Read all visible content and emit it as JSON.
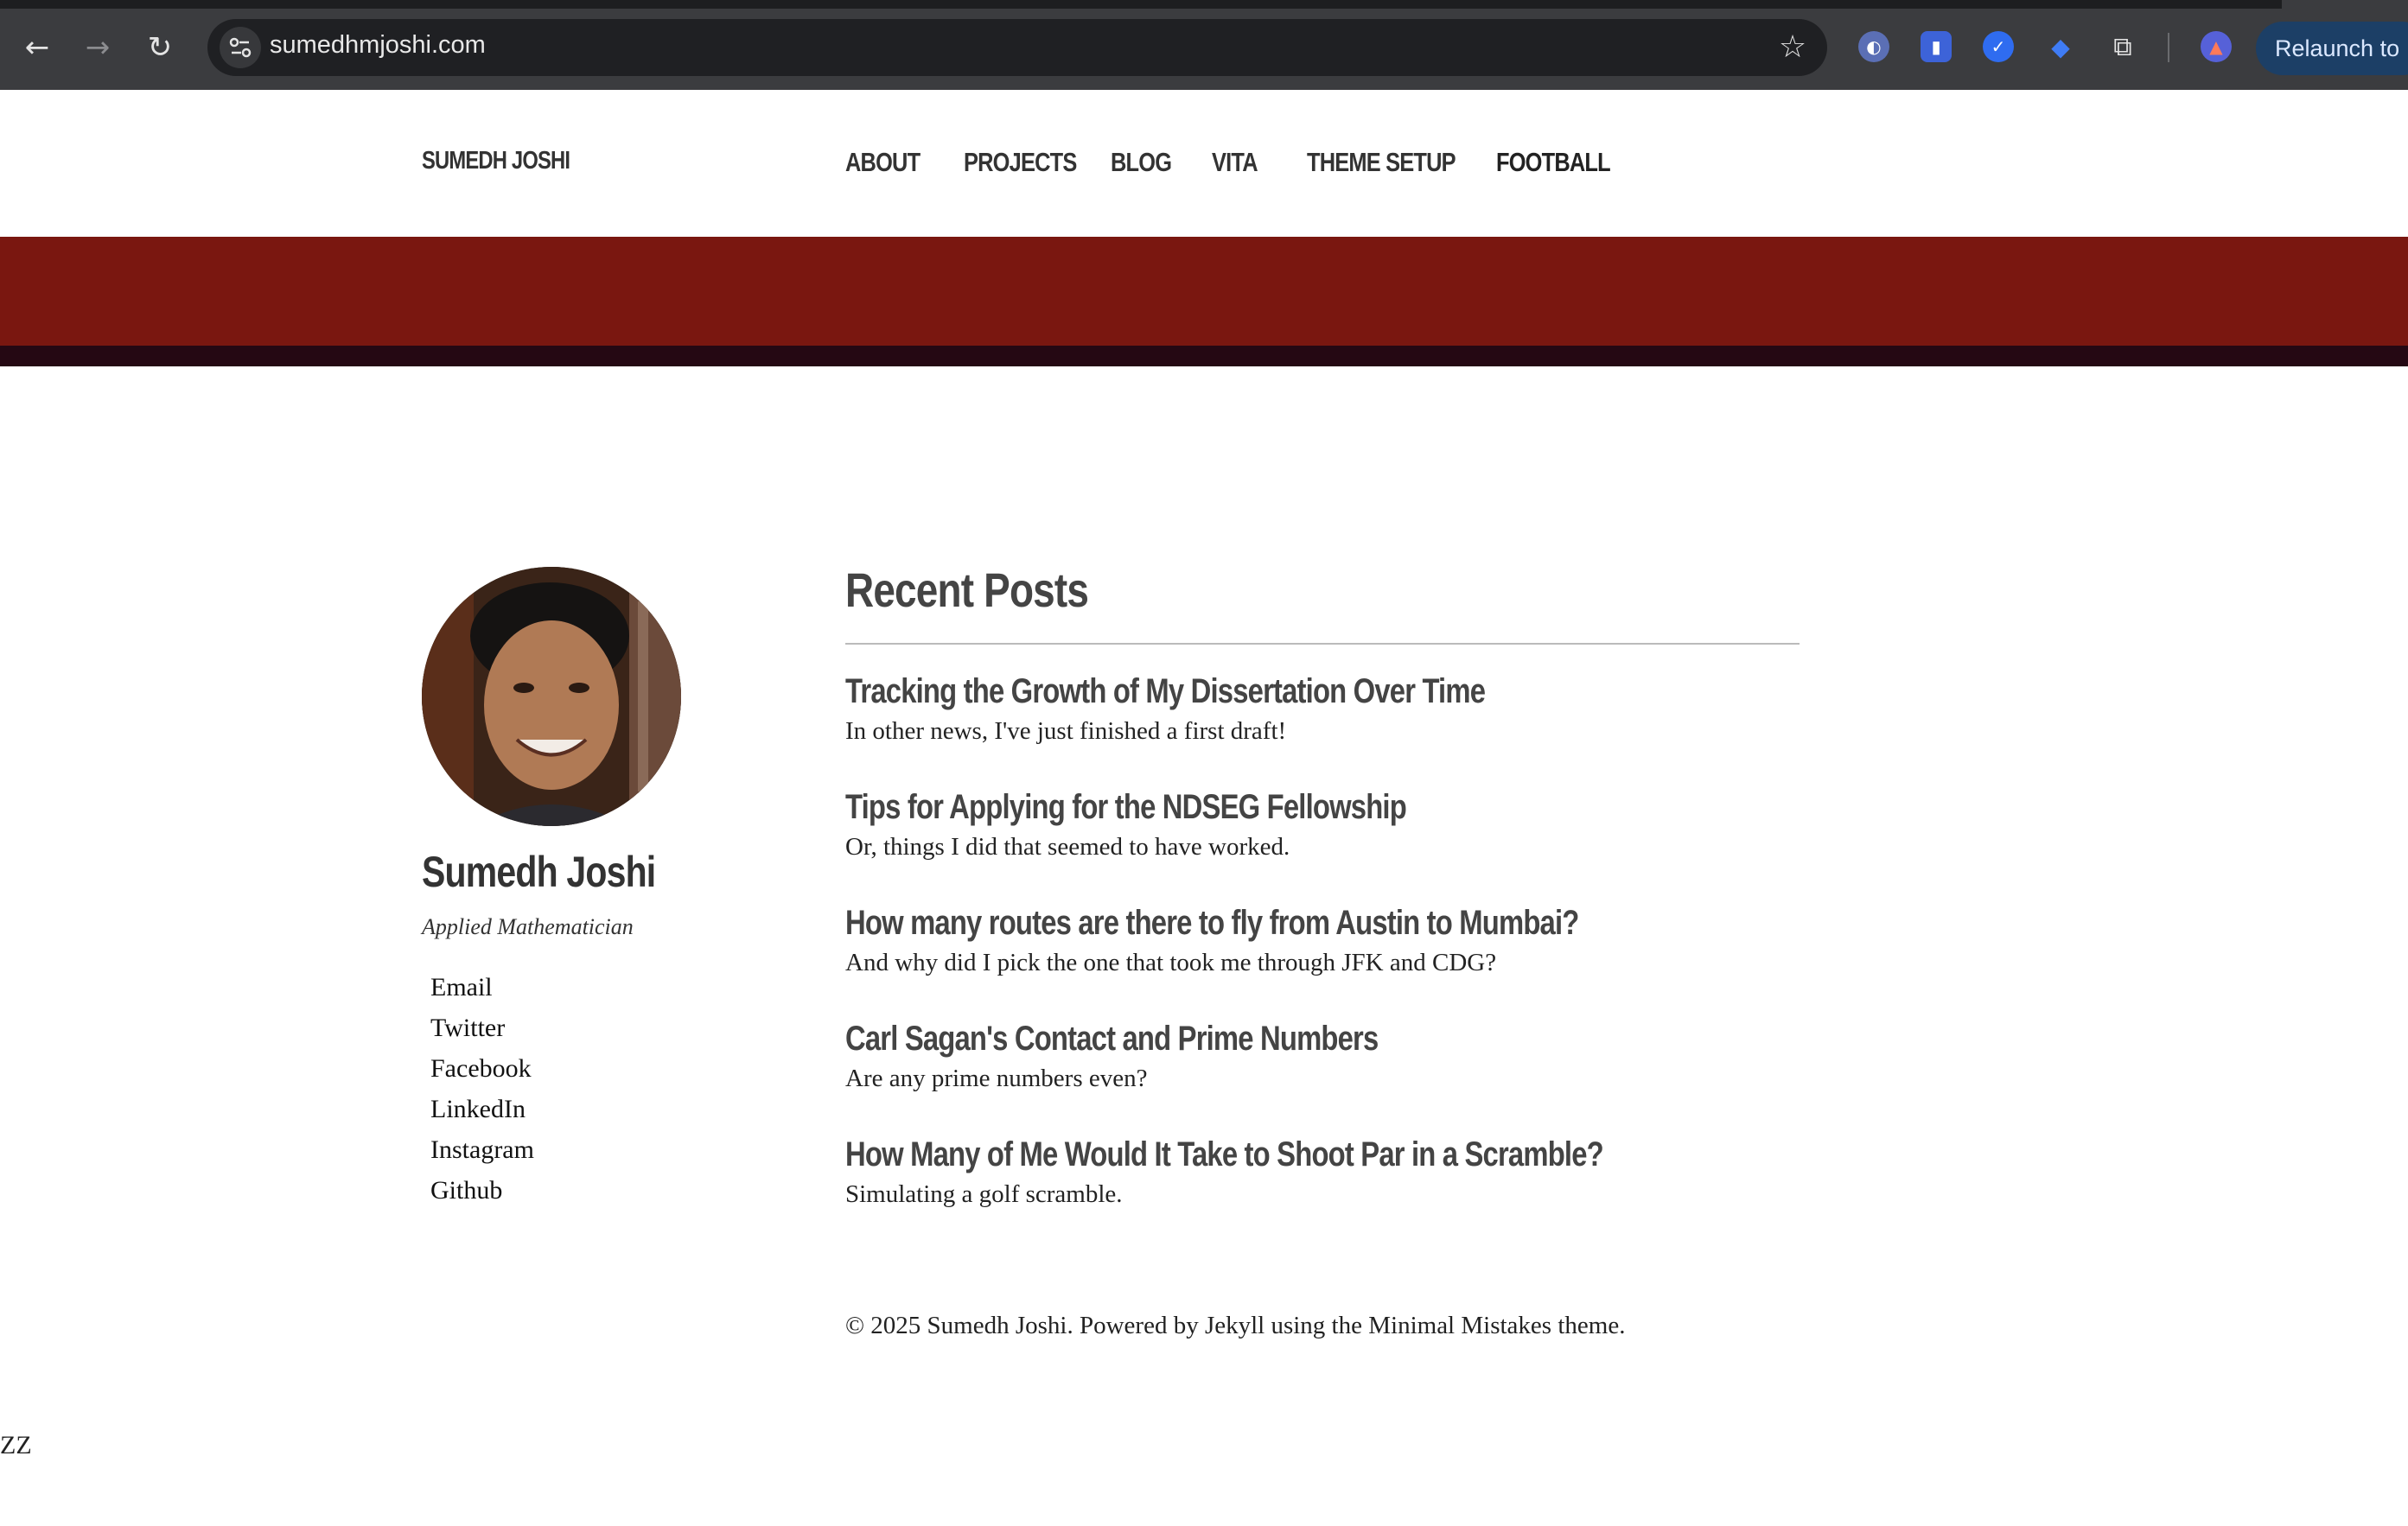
{
  "browser": {
    "url": "sumedhmjoshi.com",
    "relaunch_label": "Relaunch to"
  },
  "site": {
    "title": "SUMEDH JOSHI",
    "nav": [
      "ABOUT",
      "PROJECTS",
      "BLOG",
      "VITA",
      "THEME SETUP",
      "FOOTBALL"
    ],
    "band_color": "#7a1710"
  },
  "author": {
    "name": "Sumedh Joshi",
    "bio": "Applied Mathematician",
    "links": [
      "Email",
      "Twitter",
      "Facebook",
      "LinkedIn",
      "Instagram",
      "Github"
    ]
  },
  "main": {
    "heading": "Recent Posts",
    "posts": [
      {
        "title": "Tracking the Growth of My Dissertation Over Time",
        "excerpt": "In other news, I've just finished a first draft!"
      },
      {
        "title": "Tips for Applying for the NDSEG Fellowship",
        "excerpt": "Or, things I did that seemed to have worked."
      },
      {
        "title": "How many routes are there to fly from Austin to Mumbai?",
        "excerpt": "And why did I pick the one that took me through JFK and CDG?"
      },
      {
        "title": "Carl Sagan's Contact and Prime Numbers",
        "excerpt": "Are any prime numbers even?"
      },
      {
        "title": "How Many of Me Would It Take to Shoot Par in a Scramble?",
        "excerpt": "Simulating a golf scramble."
      }
    ]
  },
  "footer": {
    "text": "© 2025 Sumedh Joshi. Powered by Jekyll using the Minimal Mistakes theme."
  },
  "stray_text": "ZZ"
}
